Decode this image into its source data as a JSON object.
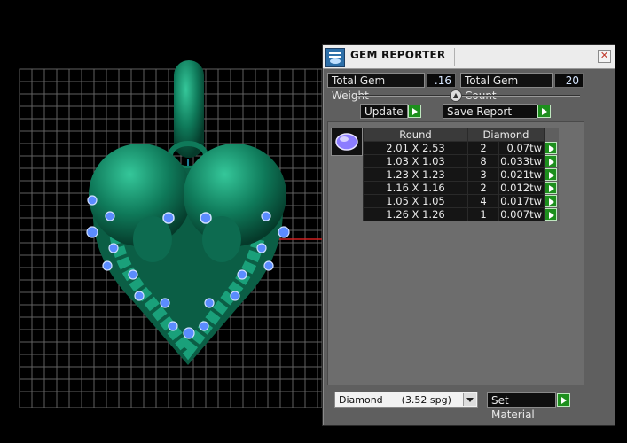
{
  "window": {
    "title": "GEM REPORTER"
  },
  "totals": {
    "weight_label": "Total Gem Weight",
    "weight_value": ".16",
    "count_label": "Total Gem Count",
    "count_value": "20"
  },
  "buttons": {
    "update": "Update",
    "save_report": "Save Report",
    "set_material": "Set Material"
  },
  "table": {
    "headers": [
      "Round",
      "Diamond"
    ],
    "rows": [
      {
        "size": "2.01 X 2.53",
        "count": "2",
        "weight": "0.07tw"
      },
      {
        "size": "1.03 X 1.03",
        "count": "8",
        "weight": "0.033tw"
      },
      {
        "size": "1.23 X 1.23",
        "count": "3",
        "weight": "0.021tw"
      },
      {
        "size": "1.16 X 1.16",
        "count": "2",
        "weight": "0.012tw"
      },
      {
        "size": "1.05 X 1.05",
        "count": "4",
        "weight": "0.017tw"
      },
      {
        "size": "1.26 X 1.26",
        "count": "1",
        "weight": "0.007tw"
      }
    ]
  },
  "material": {
    "selected": "Diamond      (3.52 spg)"
  },
  "colors": {
    "model_green": "#0f7a5a",
    "gem_blue": "#5b8cff",
    "grid": "#8a8a8a",
    "button_green": "#1d8f1d"
  }
}
